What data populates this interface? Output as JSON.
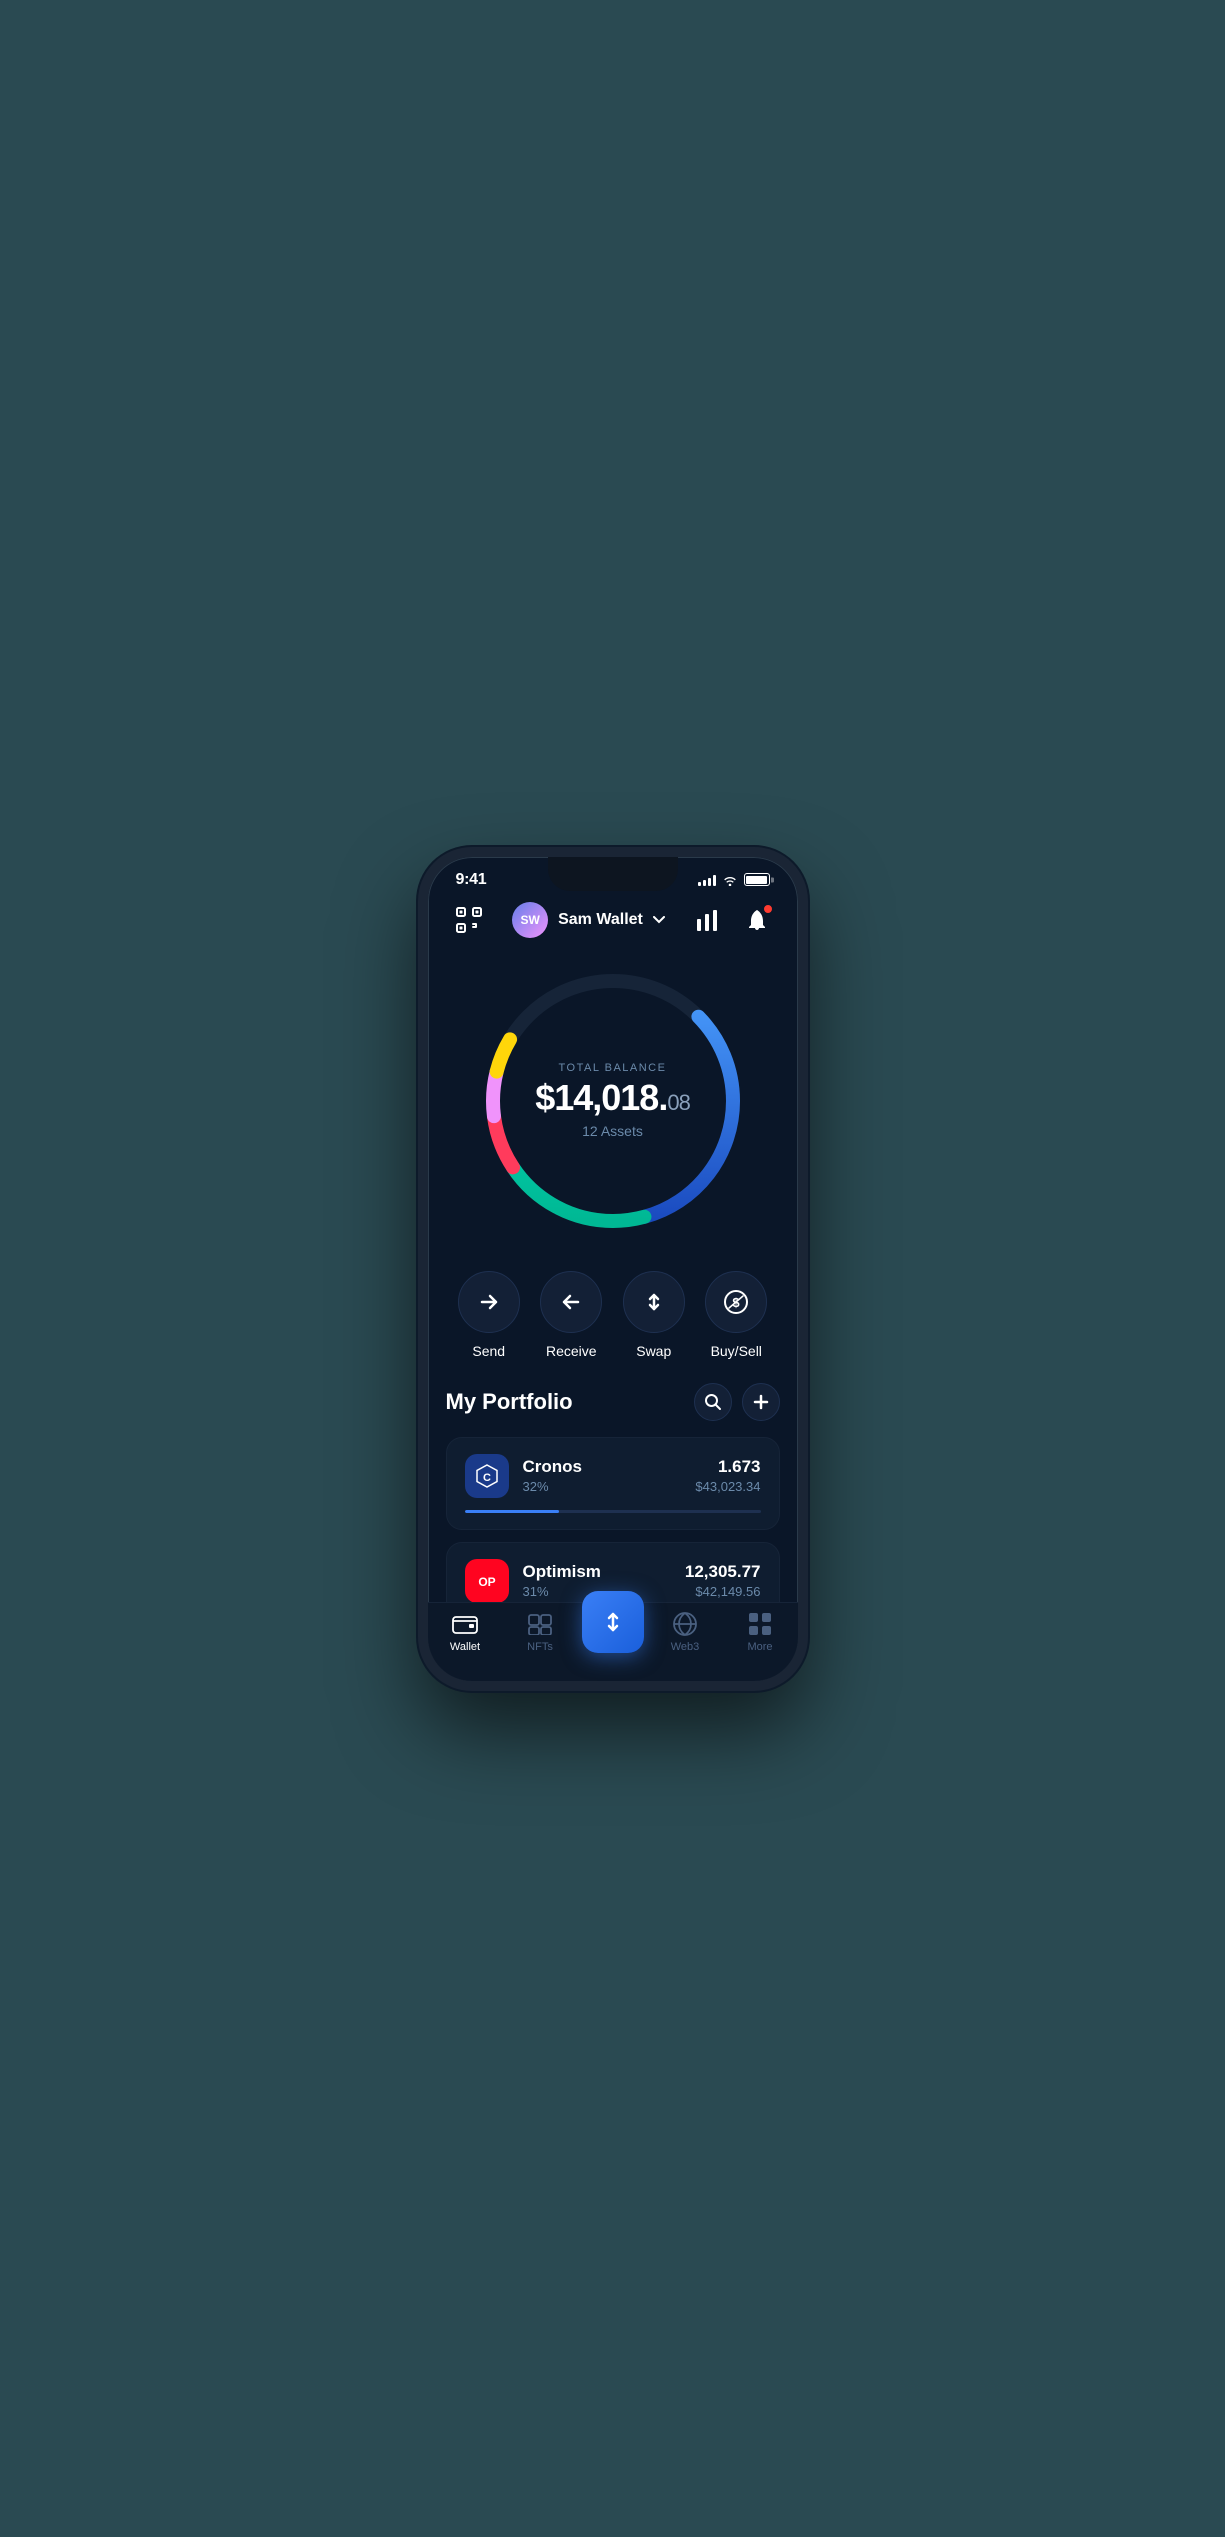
{
  "statusBar": {
    "time": "9:41"
  },
  "header": {
    "walletName": "Sam Wallet",
    "avatarInitials": "SW",
    "scanIconLabel": "scan-icon",
    "chartIconLabel": "chart-icon",
    "notificationIconLabel": "notification-icon"
  },
  "balance": {
    "label": "TOTAL BALANCE",
    "main": "$14,018.",
    "cents": "08",
    "assets": "12 Assets"
  },
  "actions": [
    {
      "id": "send",
      "label": "Send"
    },
    {
      "id": "receive",
      "label": "Receive"
    },
    {
      "id": "swap",
      "label": "Swap"
    },
    {
      "id": "buysell",
      "label": "Buy/Sell"
    }
  ],
  "portfolio": {
    "title": "My Portfolio",
    "searchLabel": "search",
    "addLabel": "add"
  },
  "assets": [
    {
      "id": "cronos",
      "name": "Cronos",
      "pct": "32%",
      "amount": "1.673",
      "value": "$43,023.34",
      "progressColor": "#3a7ff6",
      "progressWidth": 32
    },
    {
      "id": "optimism",
      "name": "Optimism",
      "pct": "31%",
      "amount": "12,305.77",
      "value": "$42,149.56",
      "progressColor": "#ff4060",
      "progressWidth": 31
    }
  ],
  "tabBar": {
    "tabs": [
      {
        "id": "wallet",
        "label": "Wallet",
        "active": true
      },
      {
        "id": "nfts",
        "label": "NFTs",
        "active": false
      },
      {
        "id": "center",
        "label": "",
        "active": false
      },
      {
        "id": "web3",
        "label": "Web3",
        "active": false
      },
      {
        "id": "more",
        "label": "More",
        "active": false
      }
    ]
  },
  "donut": {
    "segments": [
      {
        "color": "#3a7ff6",
        "offset": 25,
        "dash": 40
      },
      {
        "color": "#00c9a7",
        "offset": 65,
        "dash": 30
      },
      {
        "color": "#ff3b5c",
        "offset": 95,
        "dash": 12
      },
      {
        "color": "#f093fb",
        "offset": 107,
        "dash": 10
      },
      {
        "color": "#ffd60a",
        "offset": 117,
        "dash": 8
      }
    ]
  }
}
